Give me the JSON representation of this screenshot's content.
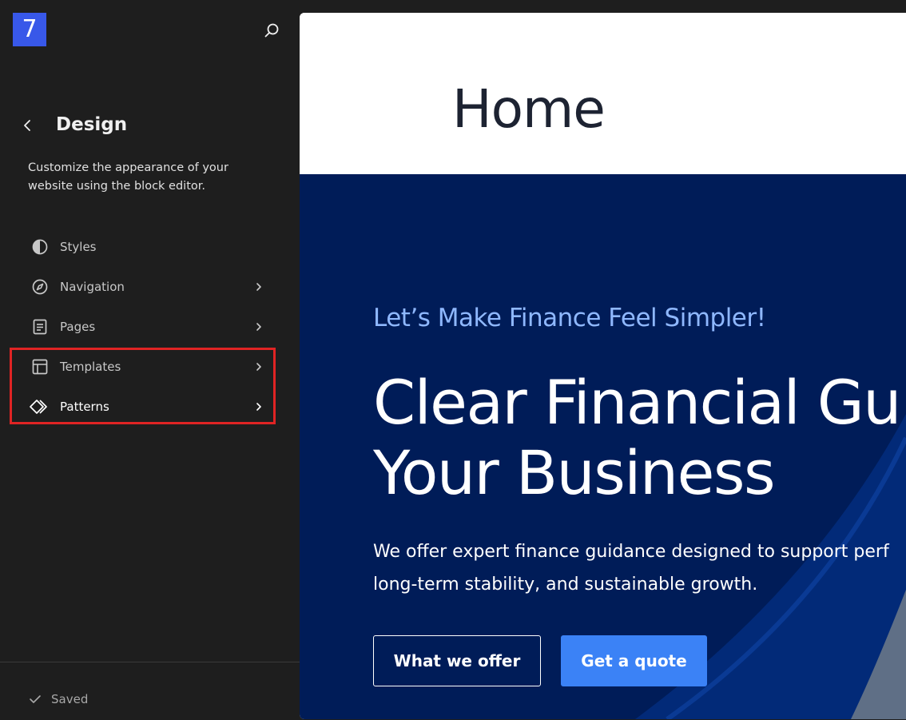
{
  "sidebar": {
    "logo_text": "7",
    "title": "Design",
    "description": "Customize the appearance of your website using the block editor.",
    "items": [
      {
        "label": "Styles",
        "icon": "styles-icon",
        "has_chevron": false
      },
      {
        "label": "Navigation",
        "icon": "compass-icon",
        "has_chevron": true
      },
      {
        "label": "Pages",
        "icon": "page-icon",
        "has_chevron": true
      },
      {
        "label": "Templates",
        "icon": "layout-icon",
        "has_chevron": true
      },
      {
        "label": "Patterns",
        "icon": "symbol-icon",
        "has_chevron": true
      }
    ],
    "status": "Saved"
  },
  "canvas": {
    "page_title": "Home",
    "hero": {
      "tagline": "Let’s Make Finance Feel Simpler!",
      "headline_line1": "Clear Financial Gui",
      "headline_line2": "Your Business",
      "description_line1": "We offer expert finance guidance designed to support perf",
      "description_line2": "long-term stability, and sustainable growth.",
      "button_outline": "What we offer",
      "button_primary": "Get a quote"
    }
  },
  "colors": {
    "sidebar_bg": "#1e1e1e",
    "logo_bg": "#3858e9",
    "hero_bg": "#001c58",
    "tagline": "#8fb8ff",
    "primary_button": "#3b82f6",
    "highlight_box": "#e02424"
  }
}
